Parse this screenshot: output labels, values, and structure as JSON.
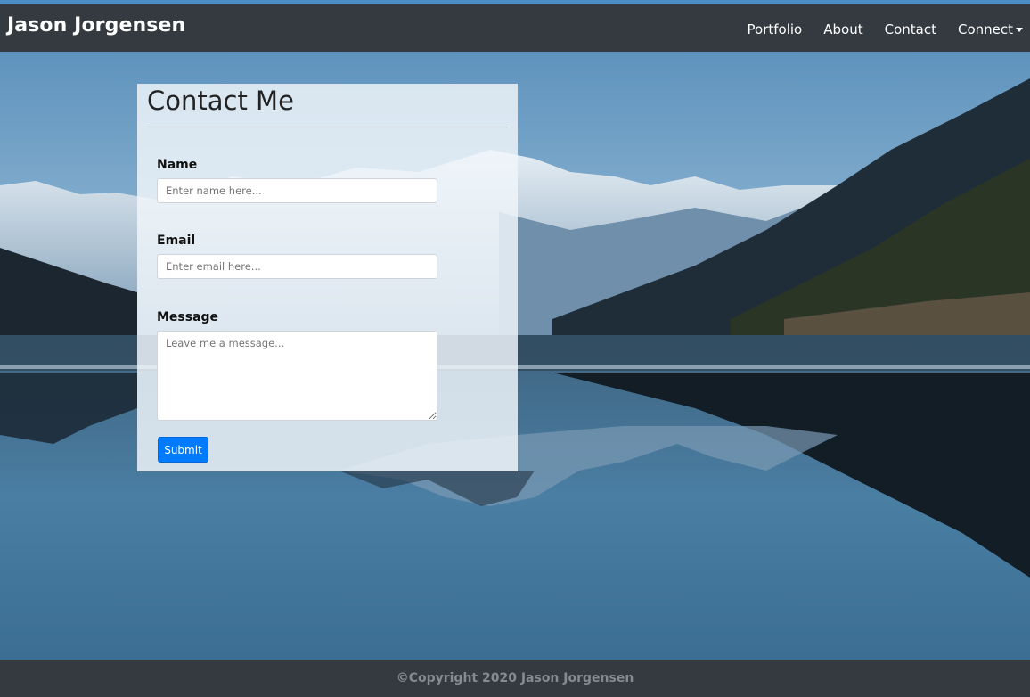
{
  "navbar": {
    "brand": "Jason Jorgensen",
    "links": [
      "Portfolio",
      "About",
      "Contact",
      "Connect"
    ]
  },
  "contact": {
    "title": "Contact Me",
    "name_label": "Name",
    "name_placeholder": "Enter name here...",
    "email_label": "Email",
    "email_placeholder": "Enter email here...",
    "message_label": "Message",
    "message_placeholder": "Leave me a message...",
    "submit_label": "Submit"
  },
  "footer": {
    "text": "©Copyright 2020 Jason Jorgensen"
  },
  "colors": {
    "navbar_bg": "#343a40",
    "accent_stripe": "#4a8cc4",
    "button_primary": "#007bff"
  }
}
